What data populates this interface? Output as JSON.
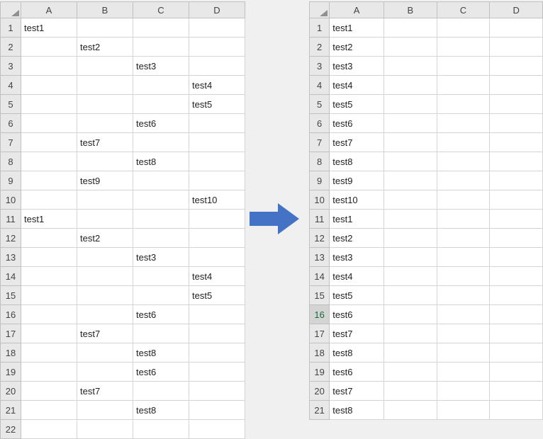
{
  "left_sheet": {
    "columns": [
      "A",
      "B",
      "C",
      "D"
    ],
    "rows": [
      {
        "n": "1",
        "cells": [
          "test1",
          "",
          "",
          ""
        ]
      },
      {
        "n": "2",
        "cells": [
          "",
          "test2",
          "",
          ""
        ]
      },
      {
        "n": "3",
        "cells": [
          "",
          "",
          "test3",
          ""
        ]
      },
      {
        "n": "4",
        "cells": [
          "",
          "",
          "",
          "test4"
        ]
      },
      {
        "n": "5",
        "cells": [
          "",
          "",
          "",
          "test5"
        ]
      },
      {
        "n": "6",
        "cells": [
          "",
          "",
          "test6",
          ""
        ]
      },
      {
        "n": "7",
        "cells": [
          "",
          "test7",
          "",
          ""
        ]
      },
      {
        "n": "8",
        "cells": [
          "",
          "",
          "test8",
          ""
        ]
      },
      {
        "n": "9",
        "cells": [
          "",
          "test9",
          "",
          ""
        ]
      },
      {
        "n": "10",
        "cells": [
          "",
          "",
          "",
          "test10"
        ]
      },
      {
        "n": "11",
        "cells": [
          "test1",
          "",
          "",
          ""
        ]
      },
      {
        "n": "12",
        "cells": [
          "",
          "test2",
          "",
          ""
        ]
      },
      {
        "n": "13",
        "cells": [
          "",
          "",
          "test3",
          ""
        ]
      },
      {
        "n": "14",
        "cells": [
          "",
          "",
          "",
          "test4"
        ]
      },
      {
        "n": "15",
        "cells": [
          "",
          "",
          "",
          "test5"
        ]
      },
      {
        "n": "16",
        "cells": [
          "",
          "",
          "test6",
          ""
        ]
      },
      {
        "n": "17",
        "cells": [
          "",
          "test7",
          "",
          ""
        ]
      },
      {
        "n": "18",
        "cells": [
          "",
          "",
          "test8",
          ""
        ]
      },
      {
        "n": "19",
        "cells": [
          "",
          "",
          "test6",
          ""
        ]
      },
      {
        "n": "20",
        "cells": [
          "",
          "test7",
          "",
          ""
        ]
      },
      {
        "n": "21",
        "cells": [
          "",
          "",
          "test8",
          ""
        ]
      },
      {
        "n": "22",
        "cells": [
          "",
          "",
          "",
          ""
        ]
      }
    ]
  },
  "right_sheet": {
    "columns": [
      "A",
      "B",
      "C",
      "D"
    ],
    "selected_row": "16",
    "rows": [
      {
        "n": "1",
        "cells": [
          "test1",
          "",
          "",
          ""
        ]
      },
      {
        "n": "2",
        "cells": [
          "test2",
          "",
          "",
          ""
        ]
      },
      {
        "n": "3",
        "cells": [
          "test3",
          "",
          "",
          ""
        ]
      },
      {
        "n": "4",
        "cells": [
          "test4",
          "",
          "",
          ""
        ]
      },
      {
        "n": "5",
        "cells": [
          "test5",
          "",
          "",
          ""
        ]
      },
      {
        "n": "6",
        "cells": [
          "test6",
          "",
          "",
          ""
        ]
      },
      {
        "n": "7",
        "cells": [
          "test7",
          "",
          "",
          ""
        ]
      },
      {
        "n": "8",
        "cells": [
          "test8",
          "",
          "",
          ""
        ]
      },
      {
        "n": "9",
        "cells": [
          "test9",
          "",
          "",
          ""
        ]
      },
      {
        "n": "10",
        "cells": [
          "test10",
          "",
          "",
          ""
        ]
      },
      {
        "n": "11",
        "cells": [
          "test1",
          "",
          "",
          ""
        ]
      },
      {
        "n": "12",
        "cells": [
          "test2",
          "",
          "",
          ""
        ]
      },
      {
        "n": "13",
        "cells": [
          "test3",
          "",
          "",
          ""
        ]
      },
      {
        "n": "14",
        "cells": [
          "test4",
          "",
          "",
          ""
        ]
      },
      {
        "n": "15",
        "cells": [
          "test5",
          "",
          "",
          ""
        ]
      },
      {
        "n": "16",
        "cells": [
          "test6",
          "",
          "",
          ""
        ]
      },
      {
        "n": "17",
        "cells": [
          "test7",
          "",
          "",
          ""
        ]
      },
      {
        "n": "18",
        "cells": [
          "test8",
          "",
          "",
          ""
        ]
      },
      {
        "n": "19",
        "cells": [
          "test6",
          "",
          "",
          ""
        ]
      },
      {
        "n": "20",
        "cells": [
          "test7",
          "",
          "",
          ""
        ]
      },
      {
        "n": "21",
        "cells": [
          "test8",
          "",
          "",
          ""
        ]
      }
    ]
  },
  "arrow_color": "#4472C4"
}
